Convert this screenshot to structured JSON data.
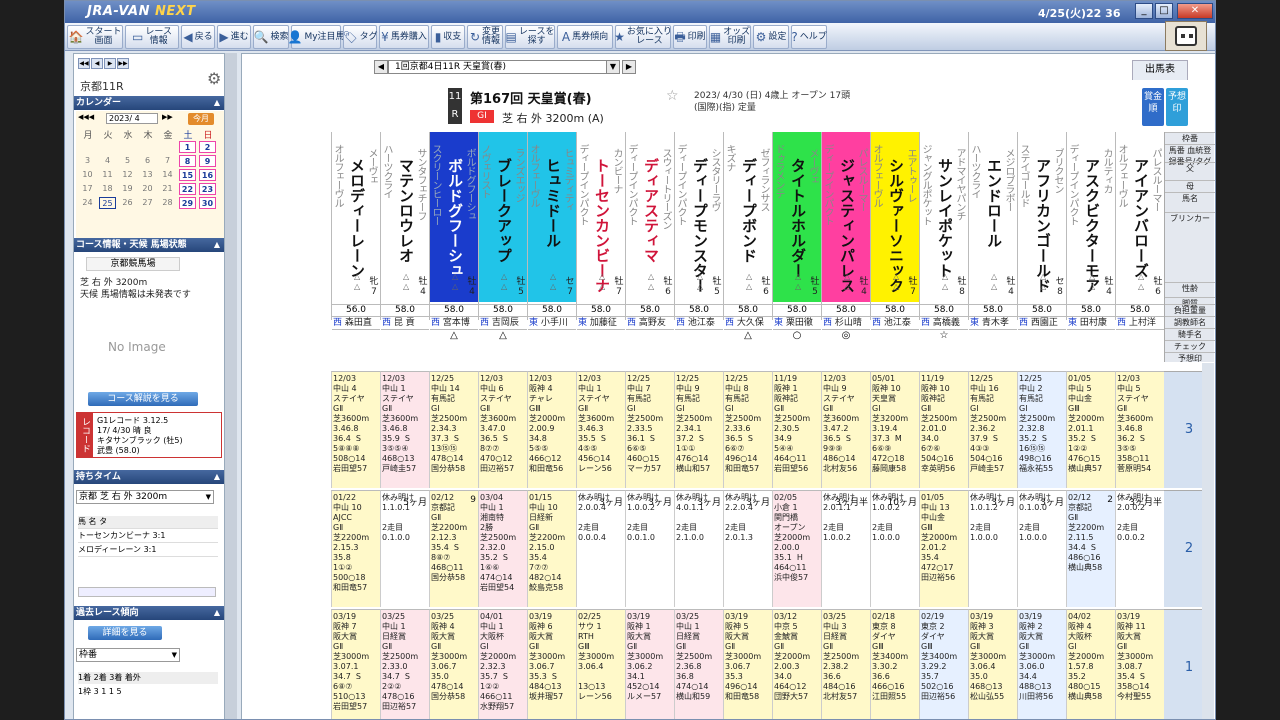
{
  "app": {
    "logo_left": "JRA-VAN",
    "logo_right": "NEXT",
    "clock": "4/25(火)22 36"
  },
  "toolbar": [
    {
      "label": "スタート\n画面",
      "icon": "🏠"
    },
    {
      "label": "レース\n情報",
      "icon": "▭"
    },
    {
      "label": "戻る",
      "icon": "◀"
    },
    {
      "label": "進む",
      "icon": "▶"
    },
    {
      "label": "検索",
      "icon": "🔍"
    },
    {
      "label": "My注目馬",
      "icon": "👤"
    },
    {
      "label": "タグ",
      "icon": "🏷"
    },
    {
      "label": "馬券購入",
      "icon": "¥"
    },
    {
      "label": "収支",
      "icon": "▮"
    },
    {
      "label": "変更\n情報",
      "icon": "↻"
    },
    {
      "label": "レースを\n探す",
      "icon": "▤"
    },
    {
      "label": "馬券傾向",
      "icon": "A"
    },
    {
      "label": "お気に入り\nレース",
      "icon": "★"
    },
    {
      "label": "印刷",
      "icon": "🖶"
    },
    {
      "label": "オッズ\n印刷",
      "icon": "▦"
    },
    {
      "label": "設定",
      "icon": "⚙"
    },
    {
      "label": "ヘルプ",
      "icon": "?"
    }
  ],
  "left": {
    "race_name": "京都11R",
    "calendar_title": "カレンダー",
    "month": "2023/ 4",
    "today_label": "今月",
    "dow": [
      "月",
      "火",
      "水",
      "木",
      "金",
      "土",
      "日"
    ],
    "weeks": [
      [
        "",
        "",
        "",
        "",
        "",
        "1",
        "2"
      ],
      [
        "3",
        "4",
        "5",
        "6",
        "7",
        "8",
        "9"
      ],
      [
        "10",
        "11",
        "12",
        "13",
        "14",
        "15",
        "16"
      ],
      [
        "17",
        "18",
        "19",
        "20",
        "21",
        "22",
        "23"
      ],
      [
        "24",
        "25",
        "26",
        "27",
        "28",
        "29",
        "30"
      ]
    ],
    "course_head": "コース情報・天候 馬場状態",
    "course": "京都競馬場",
    "course_line1": "芝 右 外 3200m",
    "course_line2": "天候 馬場情報は未発表です",
    "noimage": "No Image",
    "course_btn": "コース解説を見る",
    "record_tag": "レコード",
    "record_lines": [
      "G1レコード   3.12.5",
      "17/ 4/30 晴 良",
      "キタサンブラック (牡5)",
      "武豊        (58.0)"
    ],
    "mochi_head": "持ちタイム",
    "mochi_sel": "京都 芝 右 外 3200m",
    "mochi_cols": "馬        名         タ",
    "mochi_rows": [
      "トーセンカンビーナ  3:1",
      "メロディーレーン    3:1"
    ],
    "past_head": "過去レース傾向",
    "past_btn": "詳細を見る",
    "past_sel": "枠番",
    "past_cols": "    1着 2着 3着  着外",
    "past_row": "1枠    3   1   1    5"
  },
  "main": {
    "race_select": "1回京都4日11R 天皇賞(春)",
    "tab": "出馬表",
    "rnum": "11",
    "rsuffix": "R",
    "title": "第167回 天皇賞(春)",
    "grade": "GⅠ",
    "course": "芝 右 外 3200m (A)",
    "info1": "2023/ 4/30 (日) 4歳上 オープン 17頭",
    "info2": "(国際)(指) 定量",
    "side1": "賞金順",
    "side2": "予想印",
    "row_labels": [
      "枠番",
      "馬番 血統登録番号/タグ",
      "父",
      "母",
      "馬名",
      "ブリンカー",
      "性齢",
      "脚質",
      "負担重量",
      "調教師名",
      "騎手名",
      "チェック",
      "予想印"
    ]
  },
  "horses": [
    {
      "name": "アイアンバローズ",
      "sire": "オルフェーヴル",
      "dam": "パレスルーマー",
      "sex": "牡6",
      "wt": "58.0",
      "jk": "西 上村洋",
      "mark": "",
      "color": "#ffffff",
      "marks": "△\n△"
    },
    {
      "name": "アスクビクターモア",
      "sire": "ディープインパクト",
      "dam": "カルティカ",
      "sex": "牡4",
      "wt": "58.0",
      "jk": "東 田村康",
      "mark": "",
      "color": "#ffffff",
      "marks": "△\n△"
    },
    {
      "name": "アフリカンゴールド",
      "sire": "ステイゴールド",
      "dam": "ブリクセン",
      "sex": "セ8",
      "wt": "58.0",
      "jk": "西 西園正",
      "mark": "",
      "color": "#ffffff",
      "marks": "△\n△"
    },
    {
      "name": "エンドロール",
      "sire": "ハーツクライ",
      "dam": "メジロブラボー",
      "sex": "牡4",
      "wt": "58.0",
      "jk": "東 青木孝",
      "mark": "",
      "color": "#ffffff",
      "marks": "△\n△"
    },
    {
      "name": "サンレイポケット",
      "sire": "ジャングルポケット",
      "dam": "アドマイヤパンチ",
      "sex": "牡8",
      "wt": "58.0",
      "jk": "西 高橋義",
      "mark": "☆",
      "color": "#ffffff",
      "marks": "△\n△"
    },
    {
      "name": "シルヴァーソニック",
      "sire": "オルフェーヴル",
      "dam": "エアトゥーレ",
      "sex": "牡7",
      "wt": "58.0",
      "jk": "西 池江泰",
      "mark": "",
      "color": "#fff200",
      "marks": "△\n△"
    },
    {
      "name": "ジャスティンパレス",
      "sire": "ディープインパクト",
      "dam": "パレスルーマー",
      "sex": "牡4",
      "wt": "58.0",
      "jk": "西 杉山晴",
      "mark": "◎",
      "color": "#ff3fa0",
      "marks": "△\n△"
    },
    {
      "name": "タイトルホルダー",
      "sire": "ドゥラメンテ",
      "dam": "メーヴェ",
      "sex": "牡5",
      "wt": "58.0",
      "jk": "東 栗田徹",
      "mark": "○",
      "color": "#2ee24a",
      "marks": "△\n△"
    },
    {
      "name": "ディープボンド",
      "sire": "キズナ",
      "dam": "ゼフィランサス",
      "sex": "牡6",
      "wt": "58.0",
      "jk": "西 大久保",
      "mark": "△",
      "color": "#ffffff",
      "marks": "△\n△"
    },
    {
      "name": "ディープモンスター",
      "sire": "ディープインパクト",
      "dam": "シスタリーラヴ",
      "sex": "牡5",
      "wt": "58.0",
      "jk": "西 池江泰",
      "mark": "",
      "color": "#ffffff",
      "marks": "△\n△"
    },
    {
      "name": "ディアスティマ",
      "sire": "ディープインパクト",
      "dam": "スウィートリーズン",
      "sex": "牡6",
      "wt": "58.0",
      "jk": "西 高野友",
      "mark": "",
      "color": "#ffffff",
      "marks": "△\n△"
    },
    {
      "name": "トーセンカンビーナ",
      "sire": "ディープインパクト",
      "dam": "カンビーナ",
      "sex": "牡7",
      "wt": "58.0",
      "jk": "東 加藤征",
      "mark": "",
      "color": "#ffffff",
      "marks": "△\n△"
    },
    {
      "name": "ヒュミドール",
      "sire": "オルフェーヴル",
      "dam": "ヒュミディティ",
      "sex": "セ7",
      "wt": "58.0",
      "jk": "東 小手川",
      "mark": "",
      "color": "#21c4e8",
      "marks": "△\n△"
    },
    {
      "name": "ブレークアップ",
      "sire": "ノヴェリスト",
      "dam": "ランズエッジ",
      "sex": "牡5",
      "wt": "58.0",
      "jk": "西 吉岡辰",
      "mark": "△",
      "color": "#21c4e8",
      "marks": "△\n△"
    },
    {
      "name": "ボルドグフーシュ",
      "sire": "スクリーンヒーロー",
      "dam": "ボルドグフーシュ",
      "sex": "牡4",
      "wt": "58.0",
      "jk": "西 宮本博",
      "mark": "△",
      "color": "#1a3ccc",
      "marks": "△\n△"
    },
    {
      "name": "マテンロウレオ",
      "sire": "ハーツクライ",
      "dam": "サンタフェチーフ",
      "sex": "牡4",
      "wt": "58.0",
      "jk": "西 昆 貢",
      "mark": "",
      "color": "#ffffff",
      "marks": "△\n△"
    },
    {
      "name": "メロディーレーン",
      "sire": "オルフェーヴル",
      "dam": "メーヴェ",
      "sex": "牝7",
      "wt": "56.0",
      "jk": "西 森田直",
      "mark": "",
      "color": "#ffffff",
      "marks": "△\n△"
    }
  ],
  "runs": [
    [
      {
        "d": "12/03\n中山 4\nステイヤ\nGⅡ\n芝3600m\n3.46.8\n36.4  S\n5⑧⑧⑧\n508○14\n岩田望57",
        "p": "",
        "bg": "w"
      },
      {
        "d": "12/03\n中山 1\nステイヤ\nGⅡ\n芝3600m\n3.46.8\n35.9  S\n3⑤⑤④\n468○13\n戸崎圭57",
        "p": "",
        "bg": "r3"
      },
      {
        "d": "12/25\n中山 14\n有馬記\nGⅠ\n芝2500m\n2.34.3\n37.3  S\n13⑮⑮\n478○14\n国分恭58",
        "p": "",
        "bg": "w"
      },
      {
        "d": "12/03\n中山 6\nステイヤ\nGⅡ\n芝3600m\n3.47.0\n36.5  S\n8⑦⑦\n470○12\n田辺裕57",
        "p": "",
        "bg": "w"
      },
      {
        "d": "12/03\n阪神 4\nチャレ\nGⅢ\n芝2000m\n2.00.9\n34.8\n5⑤⑤\n466○12\n和田竜56",
        "p": "",
        "bg": "w"
      },
      {
        "d": "12/03\n中山 1\nステイヤ\nGⅡ\n芝3600m\n3.46.3\n35.5  S\n4⑤⑤\n456○14\nレーン56",
        "p": "",
        "bg": "w"
      },
      {
        "d": "12/25\n中山 7\n有馬記\nGⅠ\n芝2500m\n2.33.5\n36.1  S\n6⑥⑤\n460○15\nマーカ57",
        "p": "",
        "bg": "w"
      },
      {
        "d": "12/25\n中山 9\n有馬記\nGⅠ\n芝2500m\n2.34.1\n37.2  S\n1①①\n476○14\n横山和57",
        "p": "",
        "bg": "w"
      },
      {
        "d": "12/25\n中山 8\n有馬記\nGⅠ\n芝2500m\n2.33.6\n36.5  S\n6⑥⑦\n496○14\n和田竜57",
        "p": "",
        "bg": "w"
      },
      {
        "d": "11/19\n阪神 1\n阪神記\nGⅡ\n芝2500m\n2.30.5\n34.9\n5④④\n464○11\n岩田望56",
        "p": "",
        "bg": "w"
      },
      {
        "d": "12/03\n中山 9\nステイヤ\nGⅡ\n芝3600m\n3.47.2\n36.5  S\n9⑨⑨\n486○14\n北村友56",
        "p": "",
        "bg": "w"
      },
      {
        "d": "05/01\n阪神 10\n天皇賞\nGⅠ\n芝3200m\n3.19.4\n37.3  M\n6⑥⑨\n472○18\n藤岡康58",
        "p": "",
        "bg": "w"
      },
      {
        "d": "11/19\n阪神 10\n阪神記\nGⅡ\n芝2500m\n2.01.0\n34.0\n6⑦⑥\n504○16\n幸英明56",
        "p": "",
        "bg": "w"
      },
      {
        "d": "12/25\n中山 16\n有馬記\nGⅠ\n芝2500m\n2.36.2\n37.9  S\n4③③\n504○16\n戸崎圭57",
        "p": "",
        "bg": "w"
      },
      {
        "d": "12/25\n中山 2\n有馬記\nGⅠ\n芝2500m\n2.32.8\n35.2  S\n16⑮⑮\n498○16\n福永祐55",
        "p": "",
        "bg": "r2"
      },
      {
        "d": "01/05\n中山 5\n中山金\nGⅢ\n芝2000m\n2.01.1\n35.2  S\n1②②\n476○15\n横山典57",
        "p": "",
        "bg": "w"
      },
      {
        "d": "12/03\n中山 5\nステイヤ\nGⅡ\n芝3600m\n3.46.8\n36.2  S\n3⑤⑤\n358○11\n菅原明54",
        "p": "",
        "bg": "w"
      }
    ],
    [
      {
        "d": "01/22\n中山 10\nAJCC\nGⅡ\n芝2200m\n2.15.3\n35.8\n1①②\n500○18\n和田竜57",
        "p": "",
        "bg": "w"
      },
      {
        "d": "休み明け\n1.1.0.1\n\n2走目\n0.1.0.0",
        "p": "5ヶ月",
        "bg": "rest"
      },
      {
        "d": "02/12\n京都記\nGⅡ\n芝2200m\n2.12.3\n35.4  S\n8⑧⑦\n468○11\n国分恭58",
        "p": "9",
        "bg": "w"
      },
      {
        "d": "03/04\n中山 1\n湘南特\n2勝\n芝2500m\n2.32.0\n35.2  S\n1⑥⑥\n474○14\n岩田望54",
        "p": "",
        "bg": "r3"
      },
      {
        "d": "01/15\n中山 10\n日経新\nGⅡ\n芝2200m\n2.15.0\n35.4\n7⑦⑦\n482○14\n鮫島克58",
        "p": "",
        "bg": "w"
      },
      {
        "d": "休み明け\n2.0.0.4\n\n2走目\n0.0.0.4",
        "p": "3ヶ月",
        "bg": "rest"
      },
      {
        "d": "休み明け\n1.0.0.2\n\n2走目\n0.0.1.0",
        "p": "3ヶ月",
        "bg": "rest"
      },
      {
        "d": "休み明け\n4.0.1.1\n\n2走目\n2.1.0.0",
        "p": "3ヶ月",
        "bg": "rest"
      },
      {
        "d": "休み明け\n2.2.0.4\n\n2走目\n2.0.1.3",
        "p": "3ヶ月",
        "bg": "rest"
      },
      {
        "d": "02/05\n小倉 1\n関門橋\nオープン\n芝2000m\n2.00.0\n35.1  H\n464○11\n浜中俊57",
        "p": "",
        "bg": "r3"
      },
      {
        "d": "休み明け\n2.0.1.1\n\n2走目\n1.0.0.2",
        "p": "3ヶ月半",
        "bg": "rest"
      },
      {
        "d": "休み明け\n1.0.0.2\n\n2走目\n1.0.0.0",
        "p": "10ヶ月",
        "bg": "rest"
      },
      {
        "d": "01/05\n中山 13\n中山金\nGⅢ\n芝2000m\n2.01.2\n35.4\n472○17\n田辺裕56",
        "p": "",
        "bg": "w"
      },
      {
        "d": "休み明け\n1.0.1.2\n\n2走目\n1.0.0.0",
        "p": "3ヶ月",
        "bg": "rest"
      },
      {
        "d": "休み明け\n0.1.0.0\n\n2走目\n1.0.0.0",
        "p": "3ヶ月",
        "bg": "rest"
      },
      {
        "d": "02/12\n京都記\nGⅡ\n芝2200m\n2.11.5\n34.4  S\n486○16\n横山典58",
        "p": "2",
        "bg": "r2"
      },
      {
        "d": "休み明け\n2.0.0.2\n\n2走目\n0.0.0.2",
        "p": "3ヶ月半",
        "bg": "rest"
      }
    ],
    [
      {
        "d": "03/19\n阪神 7\n阪大賞\nGⅡ\n芝3000m\n3.07.1\n34.7  S\n6⑧⑦\n510○13\n岩田望57",
        "p": "",
        "bg": "w"
      },
      {
        "d": "03/25\n中山 1\n日経賞\nGⅡ\n芝2500m\n2.33.0\n34.7  S\n2②②\n478○16\n田辺裕57",
        "p": "",
        "bg": "r3"
      },
      {
        "d": "03/25\n阪神 4\n阪大賞\nGⅡ\n芝3000m\n3.06.7\n35.0\n478○14\n国分恭58",
        "p": "",
        "bg": "w"
      },
      {
        "d": "04/01\n中山 1\n大阪杯\nGⅠ\n芝2000m\n2.32.3\n35.7  S\n1②②\n466○11\n水野翔57",
        "p": "",
        "bg": "r3"
      },
      {
        "d": "03/19\n阪神 6\n阪大賞\nGⅡ\n芝3000m\n3.06.7\n35.3  S\n484○13\n坂井瑠57",
        "p": "",
        "bg": "w"
      },
      {
        "d": "02/25\nサウ 1\nRTH\nGⅢ\n芝3000m\n3.06.4\n\n13○13\nレーン56",
        "p": "",
        "bg": "w"
      },
      {
        "d": "03/19\n阪神 1\n阪大賞\nGⅡ\n芝3000m\n3.06.2\n34.1\n452○14\nルメー57",
        "p": "",
        "bg": "r3"
      },
      {
        "d": "03/25\n中山 1\n日経賞\nGⅡ\n芝2500m\n2.36.8\n36.8\n474○14\n横山和59",
        "p": "",
        "bg": "r3"
      },
      {
        "d": "03/19\n阪神 5\n阪大賞\nGⅡ\n芝3000m\n3.06.7\n35.3\n496○14\n和田竜58",
        "p": "",
        "bg": "w"
      },
      {
        "d": "03/12\n中京 5\n金鯱賞\nGⅡ\n芝2000m\n2.00.3\n34.0\n464○12\n団野大57",
        "p": "",
        "bg": "w"
      },
      {
        "d": "03/25\n中山 3\n日経賞\nGⅡ\n芝2500m\n2.38.2\n36.6\n484○16\n北村友57",
        "p": "",
        "bg": "w"
      },
      {
        "d": "02/18\n東京 8\nダイヤ\nGⅢ\n芝3400m\n3.30.2\n36.6\n466○16\n江田照55",
        "p": "",
        "bg": "w"
      },
      {
        "d": "02/19\n東京 2\nダイヤ\nGⅢ\n芝3400m\n3.29.2\n35.7\n502○16\n田辺裕56",
        "p": "",
        "bg": "r2"
      },
      {
        "d": "03/19\n阪神 3\n阪大賞\nGⅡ\n芝3000m\n3.06.4\n35.0\n468○13\n松山弘55",
        "p": "",
        "bg": "w"
      },
      {
        "d": "03/19\n阪神 2\n阪大賞\nGⅡ\n芝3000m\n3.06.0\n34.4\n488○13\n川田将56",
        "p": "",
        "bg": "r2"
      },
      {
        "d": "04/02\n阪神 4\n大阪杯\nGⅠ\n芝2000m\n1.57.8\n35.2\n480○15\n横山典58",
        "p": "",
        "bg": "w"
      },
      {
        "d": "03/19\n阪神 11\n阪大賞\nGⅡ\n芝3000m\n3.08.7\n35.4  S\n358○14\n今村聖55",
        "p": "",
        "bg": "w"
      }
    ]
  ],
  "run_labels": [
    "3",
    "2",
    "1"
  ]
}
